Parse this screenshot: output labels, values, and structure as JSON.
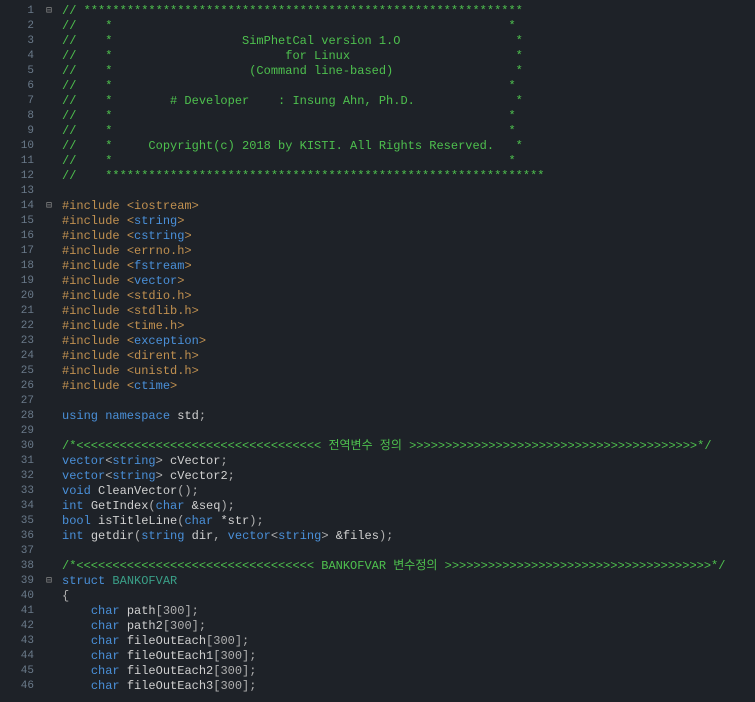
{
  "editor": {
    "lines": [
      {
        "n": 1,
        "fold": "⊟",
        "tokens": [
          {
            "t": "// ",
            "c": "c-comment"
          },
          {
            "t": "*************************************************************",
            "c": "c-comment"
          }
        ]
      },
      {
        "n": 2,
        "fold": "",
        "tokens": [
          {
            "t": "//    *                                                       *",
            "c": "c-comment"
          }
        ]
      },
      {
        "n": 3,
        "fold": "",
        "tokens": [
          {
            "t": "//    *                  SimPhetCal version 1.O                *",
            "c": "c-comment"
          }
        ]
      },
      {
        "n": 4,
        "fold": "",
        "tokens": [
          {
            "t": "//    *                        for Linux                       *",
            "c": "c-comment"
          }
        ]
      },
      {
        "n": 5,
        "fold": "",
        "tokens": [
          {
            "t": "//    *                   (Command line-based)                 *",
            "c": "c-comment"
          }
        ]
      },
      {
        "n": 6,
        "fold": "",
        "tokens": [
          {
            "t": "//    *                                                       *",
            "c": "c-comment"
          }
        ]
      },
      {
        "n": 7,
        "fold": "",
        "tokens": [
          {
            "t": "//    *        # Developer    : Insung Ahn, Ph.D.              *",
            "c": "c-comment"
          }
        ]
      },
      {
        "n": 8,
        "fold": "",
        "tokens": [
          {
            "t": "//    *                                                       *",
            "c": "c-comment"
          }
        ]
      },
      {
        "n": 9,
        "fold": "",
        "tokens": [
          {
            "t": "//    *                                                       *",
            "c": "c-comment"
          }
        ]
      },
      {
        "n": 10,
        "fold": "",
        "tokens": [
          {
            "t": "//    *     Copyright(c) 2018 by KISTI. All Rights Reserved.   *",
            "c": "c-comment"
          }
        ]
      },
      {
        "n": 11,
        "fold": "",
        "tokens": [
          {
            "t": "//    *                                                       *",
            "c": "c-comment"
          }
        ]
      },
      {
        "n": 12,
        "fold": "",
        "tokens": [
          {
            "t": "//    *************************************************************",
            "c": "c-comment"
          }
        ]
      },
      {
        "n": 13,
        "fold": "",
        "tokens": [
          {
            "t": " ",
            "c": "c-punct"
          }
        ]
      },
      {
        "n": 14,
        "fold": "⊟",
        "tokens": [
          {
            "t": "#include ",
            "c": "c-preproc"
          },
          {
            "t": "<iostream>",
            "c": "c-angle"
          }
        ]
      },
      {
        "n": 15,
        "fold": "",
        "tokens": [
          {
            "t": "#include ",
            "c": "c-preproc"
          },
          {
            "t": "<",
            "c": "c-angle"
          },
          {
            "t": "string",
            "c": "c-keyword"
          },
          {
            "t": ">",
            "c": "c-angle"
          }
        ]
      },
      {
        "n": 16,
        "fold": "",
        "tokens": [
          {
            "t": "#include ",
            "c": "c-preproc"
          },
          {
            "t": "<",
            "c": "c-angle"
          },
          {
            "t": "cstring",
            "c": "c-keyword"
          },
          {
            "t": ">",
            "c": "c-angle"
          }
        ]
      },
      {
        "n": 17,
        "fold": "",
        "tokens": [
          {
            "t": "#include ",
            "c": "c-preproc"
          },
          {
            "t": "<errno.h>",
            "c": "c-angle"
          }
        ]
      },
      {
        "n": 18,
        "fold": "",
        "tokens": [
          {
            "t": "#include ",
            "c": "c-preproc"
          },
          {
            "t": "<",
            "c": "c-angle"
          },
          {
            "t": "fstream",
            "c": "c-keyword"
          },
          {
            "t": ">",
            "c": "c-angle"
          }
        ]
      },
      {
        "n": 19,
        "fold": "",
        "tokens": [
          {
            "t": "#include ",
            "c": "c-preproc"
          },
          {
            "t": "<",
            "c": "c-angle"
          },
          {
            "t": "vector",
            "c": "c-keyword"
          },
          {
            "t": ">",
            "c": "c-angle"
          }
        ]
      },
      {
        "n": 20,
        "fold": "",
        "tokens": [
          {
            "t": "#include ",
            "c": "c-preproc"
          },
          {
            "t": "<stdio.h>",
            "c": "c-angle"
          }
        ]
      },
      {
        "n": 21,
        "fold": "",
        "tokens": [
          {
            "t": "#include ",
            "c": "c-preproc"
          },
          {
            "t": "<stdlib.h>",
            "c": "c-angle"
          }
        ]
      },
      {
        "n": 22,
        "fold": "",
        "tokens": [
          {
            "t": "#include ",
            "c": "c-preproc"
          },
          {
            "t": "<time.h>",
            "c": "c-angle"
          }
        ]
      },
      {
        "n": 23,
        "fold": "",
        "tokens": [
          {
            "t": "#include ",
            "c": "c-preproc"
          },
          {
            "t": "<",
            "c": "c-angle"
          },
          {
            "t": "exception",
            "c": "c-keyword"
          },
          {
            "t": ">",
            "c": "c-angle"
          }
        ]
      },
      {
        "n": 24,
        "fold": "",
        "tokens": [
          {
            "t": "#include ",
            "c": "c-preproc"
          },
          {
            "t": "<dirent.h>",
            "c": "c-angle"
          }
        ]
      },
      {
        "n": 25,
        "fold": "",
        "tokens": [
          {
            "t": "#include ",
            "c": "c-preproc"
          },
          {
            "t": "<unistd.h>",
            "c": "c-angle"
          }
        ]
      },
      {
        "n": 26,
        "fold": "",
        "tokens": [
          {
            "t": "#include ",
            "c": "c-preproc"
          },
          {
            "t": "<",
            "c": "c-angle"
          },
          {
            "t": "ctime",
            "c": "c-keyword"
          },
          {
            "t": ">",
            "c": "c-angle"
          }
        ]
      },
      {
        "n": 27,
        "fold": "",
        "tokens": [
          {
            "t": " ",
            "c": "c-punct"
          }
        ]
      },
      {
        "n": 28,
        "fold": "",
        "tokens": [
          {
            "t": "using namespace ",
            "c": "c-keyword"
          },
          {
            "t": "std",
            "c": "c-ident"
          },
          {
            "t": ";",
            "c": "c-punct"
          }
        ]
      },
      {
        "n": 29,
        "fold": "",
        "tokens": [
          {
            "t": " ",
            "c": "c-punct"
          }
        ]
      },
      {
        "n": 30,
        "fold": "",
        "tokens": [
          {
            "t": "/*<<<<<<<<<<<<<<<<<<<<<<<<<<<<<<<<<< 전역변수 정의 >>>>>>>>>>>>>>>>>>>>>>>>>>>>>>>>>>>>>>>>*/",
            "c": "c-comment"
          }
        ]
      },
      {
        "n": 31,
        "fold": "",
        "tokens": [
          {
            "t": "vector",
            "c": "c-type"
          },
          {
            "t": "<",
            "c": "c-punct"
          },
          {
            "t": "string",
            "c": "c-type"
          },
          {
            "t": "> ",
            "c": "c-punct"
          },
          {
            "t": "cVector",
            "c": "c-ident"
          },
          {
            "t": ";",
            "c": "c-punct"
          }
        ]
      },
      {
        "n": 32,
        "fold": "",
        "tokens": [
          {
            "t": "vector",
            "c": "c-type"
          },
          {
            "t": "<",
            "c": "c-punct"
          },
          {
            "t": "string",
            "c": "c-type"
          },
          {
            "t": "> ",
            "c": "c-punct"
          },
          {
            "t": "cVector2",
            "c": "c-ident"
          },
          {
            "t": ";",
            "c": "c-punct"
          }
        ]
      },
      {
        "n": 33,
        "fold": "",
        "tokens": [
          {
            "t": "void ",
            "c": "c-keyword"
          },
          {
            "t": "CleanVector",
            "c": "c-ident"
          },
          {
            "t": "();",
            "c": "c-punct"
          }
        ]
      },
      {
        "n": 34,
        "fold": "",
        "tokens": [
          {
            "t": "int ",
            "c": "c-keyword"
          },
          {
            "t": "GetIndex",
            "c": "c-ident"
          },
          {
            "t": "(",
            "c": "c-punct"
          },
          {
            "t": "char ",
            "c": "c-keyword"
          },
          {
            "t": "&seq",
            "c": "c-ident"
          },
          {
            "t": ");",
            "c": "c-punct"
          }
        ]
      },
      {
        "n": 35,
        "fold": "",
        "tokens": [
          {
            "t": "bool ",
            "c": "c-keyword"
          },
          {
            "t": "isTitleLine",
            "c": "c-ident"
          },
          {
            "t": "(",
            "c": "c-punct"
          },
          {
            "t": "char ",
            "c": "c-keyword"
          },
          {
            "t": "*str",
            "c": "c-ident"
          },
          {
            "t": ");",
            "c": "c-punct"
          }
        ]
      },
      {
        "n": 36,
        "fold": "",
        "tokens": [
          {
            "t": "int ",
            "c": "c-keyword"
          },
          {
            "t": "getdir",
            "c": "c-ident"
          },
          {
            "t": "(",
            "c": "c-punct"
          },
          {
            "t": "string ",
            "c": "c-type"
          },
          {
            "t": "dir",
            "c": "c-ident"
          },
          {
            "t": ", ",
            "c": "c-punct"
          },
          {
            "t": "vector",
            "c": "c-type"
          },
          {
            "t": "<",
            "c": "c-punct"
          },
          {
            "t": "string",
            "c": "c-type"
          },
          {
            "t": "> ",
            "c": "c-punct"
          },
          {
            "t": "&files",
            "c": "c-ident"
          },
          {
            "t": ");",
            "c": "c-punct"
          }
        ]
      },
      {
        "n": 37,
        "fold": "",
        "tokens": [
          {
            "t": " ",
            "c": "c-punct"
          }
        ]
      },
      {
        "n": 38,
        "fold": "",
        "tokens": [
          {
            "t": "/*<<<<<<<<<<<<<<<<<<<<<<<<<<<<<<<<< BANKOFVAR 변수정의 >>>>>>>>>>>>>>>>>>>>>>>>>>>>>>>>>>>>>*/",
            "c": "c-comment"
          }
        ]
      },
      {
        "n": 39,
        "fold": "⊟",
        "tokens": [
          {
            "t": "struct ",
            "c": "c-struct"
          },
          {
            "t": "BANKOFVAR",
            "c": "c-name"
          }
        ]
      },
      {
        "n": 40,
        "fold": "",
        "tokens": [
          {
            "t": "{",
            "c": "c-punct"
          }
        ]
      },
      {
        "n": 41,
        "fold": "",
        "tokens": [
          {
            "t": "    ",
            "c": "c-punct"
          },
          {
            "t": "char ",
            "c": "c-keyword"
          },
          {
            "t": "path",
            "c": "c-ident"
          },
          {
            "t": "[300];",
            "c": "c-punct"
          }
        ]
      },
      {
        "n": 42,
        "fold": "",
        "tokens": [
          {
            "t": "    ",
            "c": "c-punct"
          },
          {
            "t": "char ",
            "c": "c-keyword"
          },
          {
            "t": "path2",
            "c": "c-ident"
          },
          {
            "t": "[300];",
            "c": "c-punct"
          }
        ]
      },
      {
        "n": 43,
        "fold": "",
        "tokens": [
          {
            "t": "    ",
            "c": "c-punct"
          },
          {
            "t": "char ",
            "c": "c-keyword"
          },
          {
            "t": "fileOutEach",
            "c": "c-ident"
          },
          {
            "t": "[300];",
            "c": "c-punct"
          }
        ]
      },
      {
        "n": 44,
        "fold": "",
        "tokens": [
          {
            "t": "    ",
            "c": "c-punct"
          },
          {
            "t": "char ",
            "c": "c-keyword"
          },
          {
            "t": "fileOutEach1",
            "c": "c-ident"
          },
          {
            "t": "[300];",
            "c": "c-punct"
          }
        ]
      },
      {
        "n": 45,
        "fold": "",
        "tokens": [
          {
            "t": "    ",
            "c": "c-punct"
          },
          {
            "t": "char ",
            "c": "c-keyword"
          },
          {
            "t": "fileOutEach2",
            "c": "c-ident"
          },
          {
            "t": "[300];",
            "c": "c-punct"
          }
        ]
      },
      {
        "n": 46,
        "fold": "",
        "tokens": [
          {
            "t": "    ",
            "c": "c-punct"
          },
          {
            "t": "char ",
            "c": "c-keyword"
          },
          {
            "t": "fileOutEach3",
            "c": "c-ident"
          },
          {
            "t": "[300];",
            "c": "c-punct"
          }
        ]
      }
    ]
  }
}
